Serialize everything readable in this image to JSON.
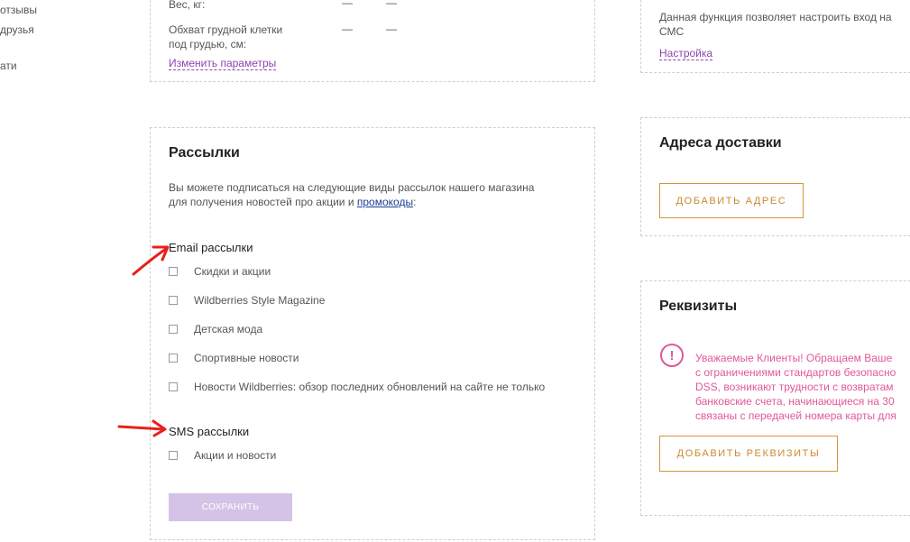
{
  "sidebar": {
    "links": [
      "отзывы",
      "друзья",
      "ати"
    ]
  },
  "params": {
    "rows": [
      {
        "label": "Вес, кг:",
        "v1": "—",
        "v2": "—"
      },
      {
        "label_l1": "Обхват грудной клетки",
        "label_l2": "под грудью, см:",
        "v1": "—",
        "v2": "—"
      }
    ],
    "change_link": "Изменить параметры"
  },
  "sms_login": {
    "desc_l1": "Данная функция позволяет настроить вход на",
    "desc_l2": "СМС",
    "settings_link": "Настройка"
  },
  "subscriptions": {
    "title": "Рассылки",
    "desc_l1": "Вы можете подписаться на следующие виды рассылок нашего магазина",
    "desc_l2_pre": "для получения новостей про акции и ",
    "desc_l2_link": "промокоды",
    "desc_l2_post": ":",
    "email_label": "Email рассылки",
    "email_items": [
      "Скидки и акции",
      "Wildberries Style Magazine",
      "Детская мода",
      "Спортивные новости",
      "Новости Wildberries: обзор последних обновлений на сайте не только"
    ],
    "sms_label": "SMS рассылки",
    "sms_items": [
      "Акции и новости"
    ],
    "save_label": "СОХРАНИТЬ"
  },
  "delivery": {
    "title": "Адреса доставки",
    "add_label": "ДОБАВИТЬ АДРЕС"
  },
  "requisites": {
    "title": "Реквизиты",
    "notice_lines": [
      "Уважаемые Клиенты! Обращаем Ваше",
      "с ограничениями стандартов безопасно",
      "DSS, возникают трудности с возвратам",
      "банковские счета, начинающиеся на 30",
      "связаны с передачей номера карты для"
    ],
    "add_label": "ДОБАВИТЬ РЕКВИЗИТЫ"
  },
  "colors": {
    "accent_orange": "#d4963a",
    "link_purple": "#8e44ad",
    "notice_pink": "#e0589a",
    "save_disabled": "#d4c3e6",
    "annotation_red": "#e8201a"
  }
}
